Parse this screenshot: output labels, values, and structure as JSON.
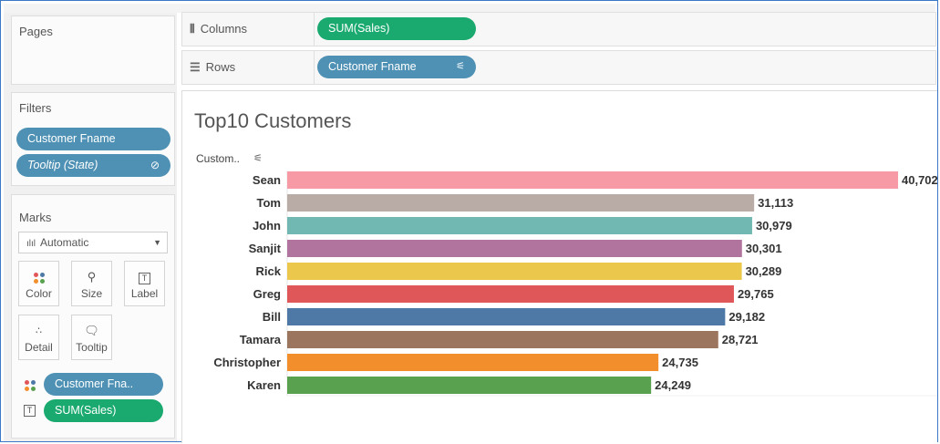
{
  "pages": {
    "title": "Pages"
  },
  "filters": {
    "title": "Filters",
    "items": [
      "Customer Fname",
      "Tooltip (State)"
    ]
  },
  "marks": {
    "title": "Marks",
    "type_dropdown": "Automatic",
    "buttons": [
      {
        "label": "Color",
        "icon": "color-dots-icon"
      },
      {
        "label": "Size",
        "icon": "size-icon"
      },
      {
        "label": "Label",
        "icon": "label-icon"
      },
      {
        "label": "Detail",
        "icon": "detail-icon"
      },
      {
        "label": "Tooltip",
        "icon": "tooltip-icon"
      }
    ],
    "pills": [
      {
        "icon": "color-dots-icon",
        "label": "Customer Fna.."
      },
      {
        "icon": "label-icon",
        "label": "SUM(Sales)"
      }
    ]
  },
  "shelves": {
    "columns_label": "Columns",
    "columns_pill": "SUM(Sales)",
    "rows_label": "Rows",
    "rows_pill": "Customer Fname"
  },
  "sheet": {
    "row_header": "Custom.."
  },
  "colors": {
    "pill_blue": "#4e91b4",
    "pill_green": "#1aa96f"
  },
  "chart_data": {
    "type": "bar",
    "orientation": "horizontal",
    "title": "Top10 Customers",
    "categories": [
      "Sean",
      "Tom",
      "John",
      "Sanjit",
      "Rick",
      "Greg",
      "Bill",
      "Tamara",
      "Christopher",
      "Karen"
    ],
    "values": [
      40702,
      31113,
      30979,
      30301,
      30289,
      29765,
      29182,
      28721,
      24735,
      24249
    ],
    "value_labels": [
      "40,702",
      "31,113",
      "30,979",
      "30,301",
      "30,289",
      "29,765",
      "29,182",
      "28,721",
      "24,735",
      "24,249"
    ],
    "colors": [
      "#f89aa6",
      "#b9aca6",
      "#71b8b2",
      "#b0749e",
      "#ebc84c",
      "#e05759",
      "#4e79a7",
      "#9c755f",
      "#f28e2b",
      "#59a14f"
    ],
    "grid": false
  }
}
